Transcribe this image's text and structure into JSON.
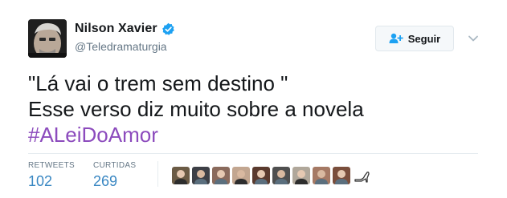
{
  "user": {
    "display_name": "Nilson Xavier",
    "handle": "@Teledramaturgia",
    "verified_icon": "verified-badge-icon",
    "avatar": "profile-avatar"
  },
  "follow_button": {
    "label": "Seguir",
    "icon": "add-user-icon"
  },
  "caret": {
    "icon": "chevron-down-icon"
  },
  "tweet": {
    "line1": "\"Lá vai o trem sem destino \"",
    "line2": "Esse verso diz muito sobre a novela",
    "hashtag": "#ALeiDoAmor"
  },
  "stats": {
    "retweets_label": "RETWEETS",
    "retweets_value": "102",
    "likes_label": "CURTIDAS",
    "likes_value": "269"
  },
  "likers": [
    {
      "name": "liker-avatar-1",
      "color": "#6b5b45"
    },
    {
      "name": "liker-avatar-2",
      "color": "#3d3f46"
    },
    {
      "name": "liker-avatar-3",
      "color": "#8a6a5c"
    },
    {
      "name": "liker-avatar-4",
      "color": "#c2a690"
    },
    {
      "name": "liker-avatar-5",
      "color": "#5a3a2e"
    },
    {
      "name": "liker-avatar-6",
      "color": "#4f4f4f"
    },
    {
      "name": "liker-avatar-7",
      "color": "#b0a79a"
    },
    {
      "name": "liker-avatar-8",
      "color": "#a57964"
    },
    {
      "name": "liker-avatar-9",
      "color": "#7a4e3c"
    }
  ],
  "colors": {
    "text": "#14171a",
    "muted": "#657786",
    "link": "#3b88c3",
    "hashtag": "#8c4bbd",
    "verified": "#1da1f2"
  }
}
